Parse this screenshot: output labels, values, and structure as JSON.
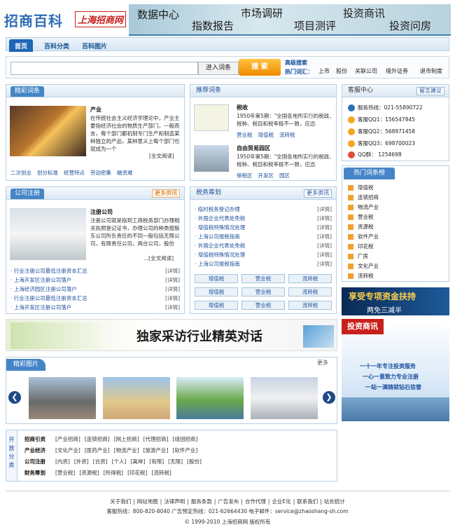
{
  "header": {
    "logo": "招商百科",
    "logo2": "上海招商网",
    "banner": [
      "数据中心",
      "市场调研",
      "投资商讯",
      "指数报告",
      "项目测评",
      "投资问房"
    ]
  },
  "nav": {
    "tabs": [
      "首页",
      "百科分类",
      "百科图片"
    ]
  },
  "search": {
    "enter_label": "进入词条",
    "search_label": "搜 索",
    "advanced": "高级搜索",
    "hot_label": "热门词汇：",
    "hot_words": [
      "上市",
      "股份",
      "关联公司",
      "境外证券",
      "退市制度"
    ]
  },
  "featured": {
    "title": "精彩词条",
    "heading": "产业",
    "text": "在传统社会主义经济学理论中，产业主要指经济社会的物质生产部门，一般而言，每个部门都机制专门生产和制造某种独立的产品，某种意义上每个部门也就成为一个",
    "read": "[全文阅读]",
    "tags": [
      "二次创业",
      "划分标准",
      "经营特点",
      "劳动密集",
      "融资难"
    ]
  },
  "recommend": {
    "title": "推荐词条",
    "item1": {
      "heading": "税收",
      "text": "1950年第5期：\"全国各地所实行的税政、税种、税目和税率极不一致，应迅",
      "tags": [
        "营业税",
        "增值税",
        "流转税"
      ]
    },
    "item2": {
      "heading": "自由贸易园区",
      "text": "1950年第5期：\"全国各地所实行的税政、税种、税目和税率极不一致，应迅",
      "tags": [
        "保税区",
        "开发区",
        "园区"
      ]
    }
  },
  "service": {
    "title": "客服中心",
    "msg": "留言建议",
    "lines": [
      "服务热线：021-55890722",
      "客服QQ1：156547845",
      "客服QQ2：568971458",
      "客服QQ3：698700023",
      "QQ群： 1254698"
    ]
  },
  "hotlist": {
    "title": "热门词条榜",
    "items": [
      "增值税",
      "连锁招商",
      "物流产业",
      "营业税",
      "资源税",
      "软件产业",
      "印花税",
      "厂房",
      "文化产业",
      "流转税"
    ]
  },
  "company": {
    "title": "公司注册",
    "more": "更多资讯",
    "heading": "注册公司",
    "text": "注册公司就是指到工商税务部门办理相关执照登记证书，办理公司的种类按股东公司所负责任的不同一般包括无限公司，有限责任公司，两合公司，股份",
    "read": "...[全文阅读]",
    "list": [
      "行业注册公司最低注册资本汇总",
      "上海开发区注册公司落户",
      "上海经济园区注册公司落户",
      "行业注册公司最低注册资本汇总",
      "上海开发区注册公司落户"
    ],
    "det": "[详情]"
  },
  "tax": {
    "title": "税务筹划",
    "more": "更多资讯",
    "list": [
      "临时税务登记办理",
      "外国企业代表处免税",
      "增值税特殊情况处理",
      "上海公司报税指南",
      "外国企业代表处免税",
      "增值税特殊情况处理",
      "上海公司报税指南"
    ],
    "det": "[详情]",
    "buttons": [
      "增值税",
      "营业税",
      "流转税",
      "增值税",
      "营业税",
      "流转税",
      "增值税",
      "营业税",
      "流转税"
    ]
  },
  "ad1": {
    "text": "享受专项资金扶持",
    "sub": "两免三减半"
  },
  "ad2": {
    "text": "独家采访行业精英对话"
  },
  "ad3": {
    "title": "投资商讯",
    "l1": "一十一年专注投资服务",
    "l2": "一心一意致力专业注册",
    "l3": "一站一满铸就钻石信誉"
  },
  "pics": {
    "title": "精彩图片",
    "more": "更多"
  },
  "categories": {
    "side": "开放分类",
    "rows": [
      {
        "name": "招商引资",
        "items": [
          "产业招商",
          "连锁招商",
          "网上招商",
          "代理招商",
          "组团招商"
        ]
      },
      {
        "name": "产业经济",
        "items": [
          "文化产业",
          "医药产业",
          "物流产业",
          "旅游产业",
          "软件产业"
        ]
      },
      {
        "name": "公司注册",
        "items": [
          "内资",
          "外资",
          "合资",
          "个人",
          "离岸",
          "有限",
          "无限",
          "股份"
        ]
      },
      {
        "name": "财务筹划",
        "items": [
          "营业税",
          "资源税",
          "所得税",
          "印花税",
          "流转税"
        ]
      }
    ]
  },
  "footer": {
    "links": [
      "关于我们",
      "网站地图",
      "法律声明",
      "服务条款",
      "广告发布",
      "合作代理",
      "企业E化",
      "联系我们",
      "站长统计"
    ],
    "contact": "客服热线：800-820-8040 广告预定热线：021-62664430 电子邮件：service@zhaoshang-sh.com",
    "copyright": "© 1999-2010 上海招商网 版权所有"
  }
}
